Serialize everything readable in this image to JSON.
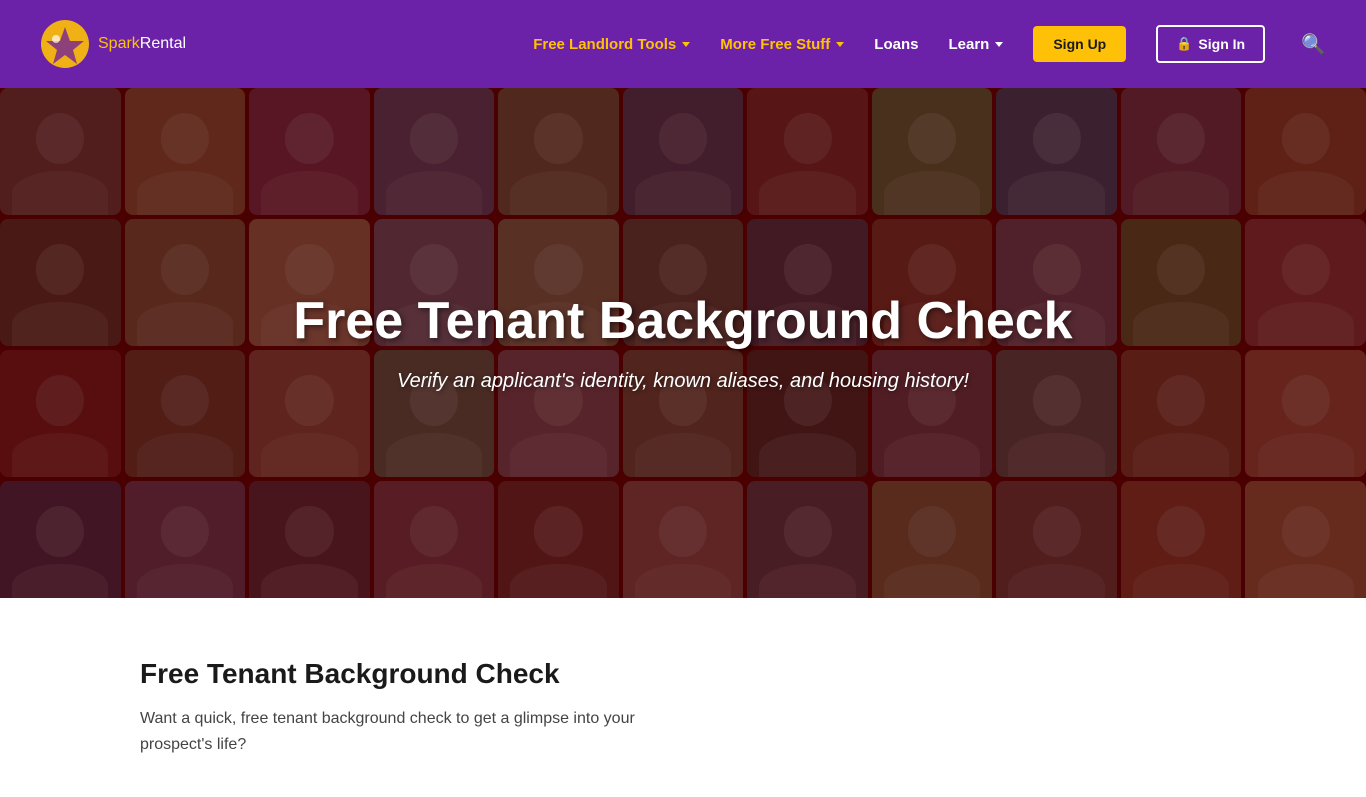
{
  "header": {
    "logo": {
      "spark": "Spark",
      "rental": "Rental"
    },
    "nav": {
      "free_landlord_tools": "Free Landlord Tools",
      "more_free_stuff": "More Free Stuff",
      "loans": "Loans",
      "learn": "Learn",
      "sign_up": "Sign Up",
      "sign_in": "Sign In"
    }
  },
  "hero": {
    "title": "Free Tenant Background Check",
    "subtitle": "Verify an applicant's identity, known aliases, and housing history!"
  },
  "content": {
    "title": "Free Tenant Background Check",
    "text_line1": "Want a quick, free tenant background check to get a glimpse into your",
    "text_line2": "prospect's life?"
  }
}
